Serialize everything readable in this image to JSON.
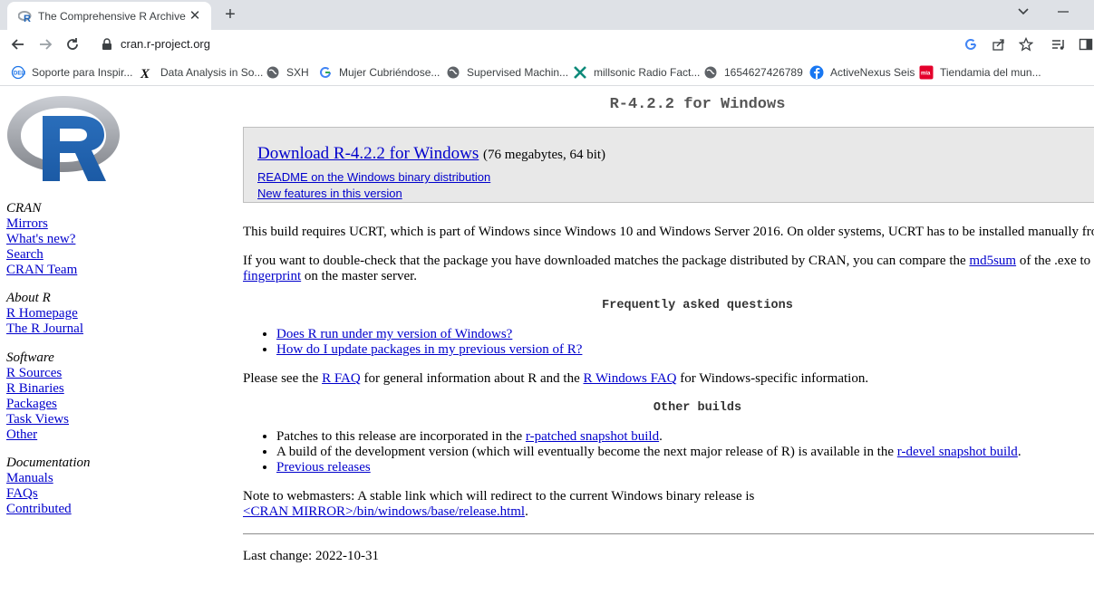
{
  "browser": {
    "tab": {
      "title": "The Comprehensive R Archive Ne"
    },
    "address": {
      "url": "cran.r-project.org"
    },
    "bookmarks": [
      {
        "label": "Soporte para Inspir...",
        "icon": "dell-icon"
      },
      {
        "label": "Data Analysis in So...",
        "icon": "x-logo-icon"
      },
      {
        "label": "SXH",
        "icon": "globe-icon"
      },
      {
        "label": "Mujer Cubriéndose...",
        "icon": "google-icon"
      },
      {
        "label": "Supervised Machin...",
        "icon": "globe-icon"
      },
      {
        "label": "millsonic Radio Fact...",
        "icon": "star-logo-icon"
      },
      {
        "label": "1654627426789",
        "icon": "globe-icon"
      },
      {
        "label": "ActiveNexus Seis",
        "icon": "facebook-icon"
      },
      {
        "label": "Tiendamia del mun...",
        "icon": "tiendamia-icon"
      }
    ]
  },
  "sidebar": {
    "groups": [
      {
        "heading": "CRAN",
        "links": [
          "Mirrors",
          "What's new?",
          "Search",
          "CRAN Team"
        ]
      },
      {
        "heading": "About R",
        "links": [
          "R Homepage",
          "The R Journal"
        ]
      },
      {
        "heading": "Software",
        "links": [
          "R Sources",
          "R Binaries",
          "Packages",
          "Task Views",
          "Other"
        ]
      },
      {
        "heading": "Documentation",
        "links": [
          "Manuals",
          "FAQs",
          "Contributed"
        ]
      }
    ]
  },
  "main": {
    "title": "R-4.2.2 for Windows",
    "download": {
      "link": "Download R-4.2.2 for Windows",
      "note": "(76 megabytes, 64 bit)",
      "readme": "README on the Windows binary distribution",
      "features": "New features in this version"
    },
    "ucrt_text": "This build requires UCRT, which is part of Windows since Windows 10 and Windows Server 2016. On older systems, UCRT has to be installed manually fro",
    "check": {
      "pre": "If you want to double-check that the package you have downloaded matches the package distributed by CRAN, you can compare the ",
      "md5": "md5sum",
      "mid": " of the .exe to",
      "fingerprint": "fingerprint",
      "post": " on the master server."
    },
    "faq_heading": "Frequently asked questions",
    "faq_items": [
      "Does R run under my version of Windows?",
      "How do I update packages in my previous version of R?"
    ],
    "see": {
      "pre": "Please see the ",
      "rfaq": "R FAQ",
      "mid": " for general information about R and the ",
      "winfaq": "R Windows FAQ",
      "post": " for Windows-specific information."
    },
    "other_heading": "Other builds",
    "other": {
      "patches_pre": "Patches to this release are incorporated in the ",
      "patches_link": "r-patched snapshot build",
      "patches_post": ".",
      "devel_pre": "A build of the development version (which will eventually become the next major release of R) is available in the ",
      "devel_link": "r-devel snapshot build",
      "devel_post": ".",
      "previous": "Previous releases"
    },
    "webmasters": {
      "text": "Note to webmasters: A stable link which will redirect to the current Windows binary release is",
      "link": "<CRAN MIRROR>/bin/windows/base/release.html",
      "post": "."
    },
    "last_change": "Last change: 2022-10-31"
  }
}
